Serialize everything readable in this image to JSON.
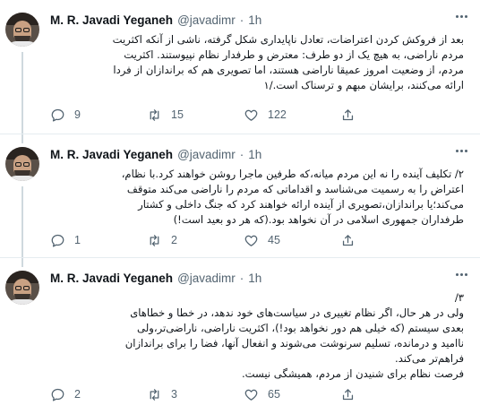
{
  "tweets": [
    {
      "author_name": "M. R. Javadi Yeganeh",
      "handle": "@javadimr",
      "separator": "·",
      "time": "1h",
      "avatar_icon": "profile-photo",
      "lines": [
        "بعد از فروکش کردن اعتراضات، تعادل ناپایداری شکل گرفته، ناشی از آنکه اکثریت",
        "مردم ناراضی، به هیچ یک از دو طرف: معترض و طرفدار نظام نپیوستند. اکثریت",
        "مردم، از وضعیت امروز عمیقا ناراضی هستند، اما تصویری هم که براندازان از فردا",
        "ارائه می‌کنند، برایشان مبهم و ترسناک است./۱"
      ],
      "replies": "9",
      "retweets": "15",
      "likes": "122"
    },
    {
      "author_name": "M. R. Javadi Yeganeh",
      "handle": "@javadimr",
      "separator": "·",
      "time": "1h",
      "avatar_icon": "profile-photo",
      "lines": [
        "۲/ تکلیف آینده را نه این مردم میانه،که طرفین ماجرا روشن خواهند کرد.با نظام،",
        "اعتراض را به رسمیت می‌شناسد و اقداماتی که مردم را ناراضی می‌کند متوقف",
        "می‌کند؛یا براندازان،تصویری از آینده ارائه خواهند کرد که جنگ داخلی و کشتار",
        "طرفداران جمهوری اسلامی در آن نخواهد بود.(که هر دو بعید است!)"
      ],
      "replies": "1",
      "retweets": "2",
      "likes": "45"
    },
    {
      "author_name": "M. R. Javadi Yeganeh",
      "handle": "@javadimr",
      "separator": "·",
      "time": "1h",
      "avatar_icon": "profile-photo",
      "lines": [
        "۳/",
        "ولی در هر حال، اگر نظام تغییری در سیاست‌های خود ندهد، در خطا و خطاهای",
        "بعدی سیستم (که خیلی هم دور نخواهد بود!)، اکثریت ناراضی، ناراضی‌تر،ولی",
        "ناامید و درمانده، تسلیم سرنوشت می‌شوند و انفعال آنها، فضا را برای براندازان",
        "فراهم‌تر می‌کند.",
        "فرصت نظام برای شنیدن از مردم، همیشگی نیست."
      ],
      "replies": "2",
      "retweets": "3",
      "likes": "65"
    }
  ],
  "icons": {
    "reply": "reply-bubble-icon",
    "retweet": "retweet-arrows-icon",
    "like": "heart-icon",
    "share": "share-upload-icon",
    "more": "more-dots-icon"
  },
  "colors": {
    "text": "#0f1419",
    "secondary": "#536471",
    "thread_line": "#cfd9de",
    "divider": "#e6ecf0",
    "background": "#ffffff"
  }
}
